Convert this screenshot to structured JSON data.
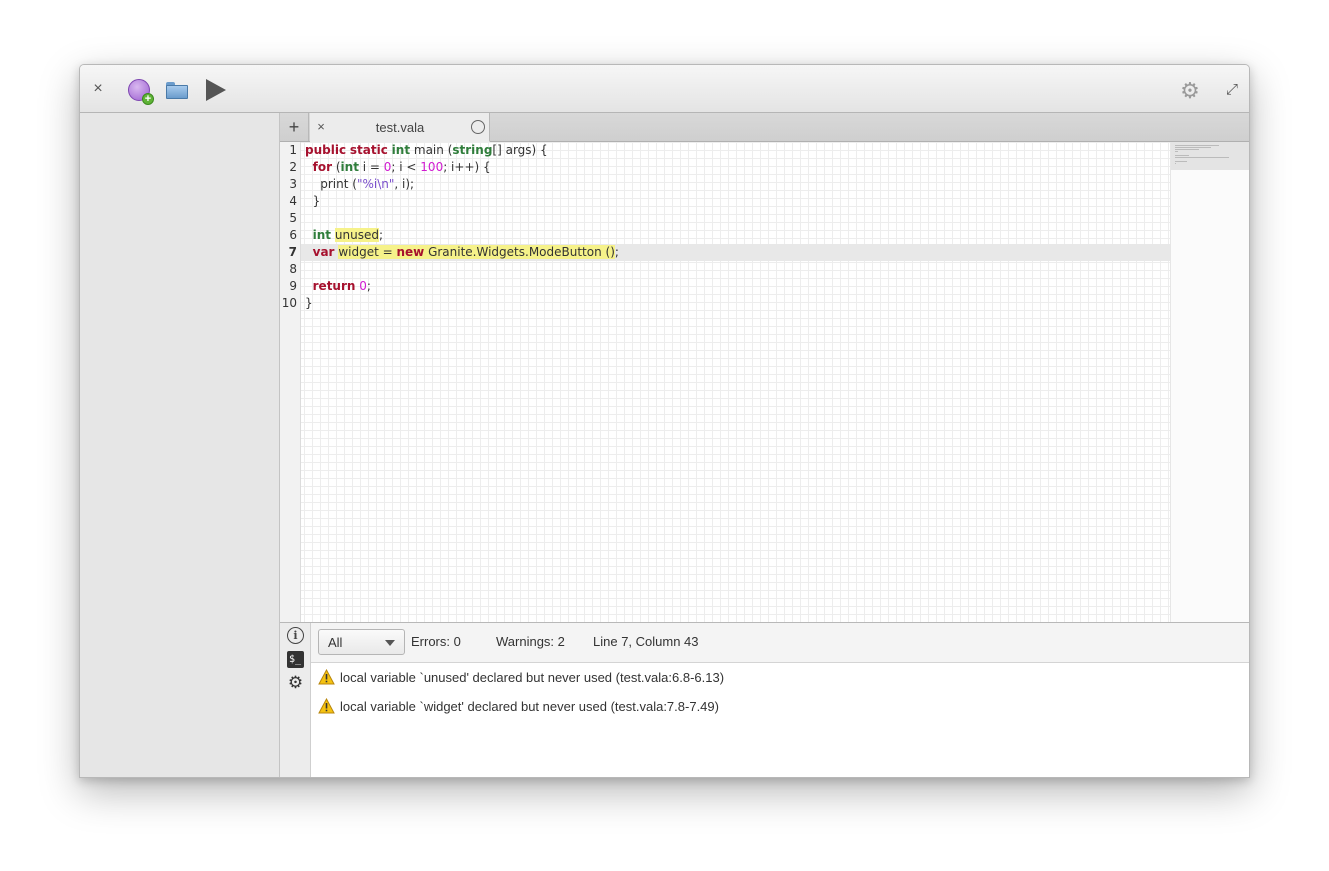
{
  "headerbar": {
    "close_glyph": "×",
    "new_icon": "new-project-icon",
    "open_icon": "open-folder-icon",
    "run_icon": "run-icon",
    "settings_icon": "settings-gear-icon",
    "maximize_glyph": "⤢"
  },
  "tabs": {
    "new_tab_glyph": "+",
    "items": [
      {
        "close_glyph": "×",
        "label": "test.vala",
        "status_icon": "circle-icon",
        "active": true
      }
    ]
  },
  "editor": {
    "current_line": 7,
    "line_numbers": [
      "1",
      "2",
      "3",
      "4",
      "5",
      "6",
      "7",
      "8",
      "9",
      "10"
    ],
    "code_lines": [
      "public static int main (string[] args) {",
      "  for (int i = 0; i < 100; i++) {",
      "    print (\"%i\\n\", i);",
      "  }",
      "",
      "  int unused;",
      "  var widget = new Granite.Widgets.ModeButton ();",
      "",
      "  return 0;",
      "}"
    ],
    "colors": {
      "keyword": "#a6112e",
      "type": "#2f7d3b",
      "number": "#d11bd1",
      "string": "#7a4fcc",
      "highlight": "#f6f28a"
    }
  },
  "bottom_panel": {
    "side_icons": [
      "info-icon",
      "terminal-icon",
      "settings-icon"
    ],
    "filter": {
      "selected": "All"
    },
    "errors_label": "Errors: 0",
    "warnings_label": "Warnings: 2",
    "position_label": "Line 7, Column 43",
    "messages": [
      {
        "icon": "warning-icon",
        "text": "local variable `unused' declared but never used (test.vala:6.8-6.13)"
      },
      {
        "icon": "warning-icon",
        "text": "local variable `widget' declared but never used (test.vala:7.8-7.49)"
      }
    ]
  }
}
